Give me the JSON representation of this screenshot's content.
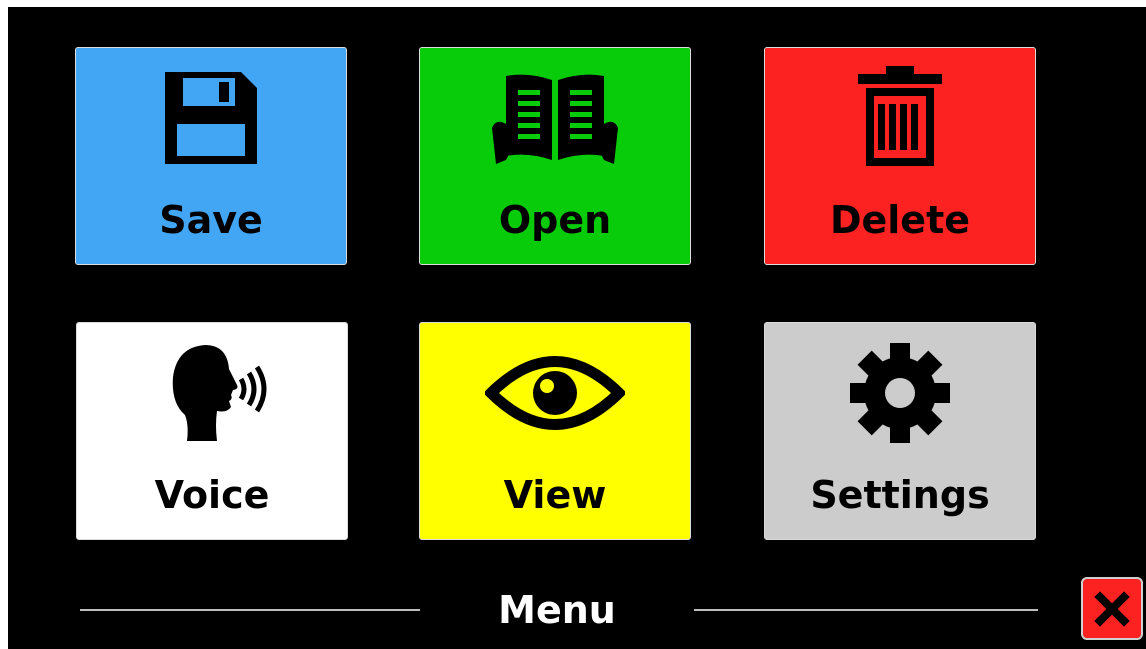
{
  "menu": {
    "title": "Menu",
    "tiles": [
      {
        "label": "Save",
        "icon": "floppy-disk-icon",
        "color": "#42a6f4"
      },
      {
        "label": "Open",
        "icon": "open-book-icon",
        "color": "#08cc0a"
      },
      {
        "label": "Delete",
        "icon": "trash-can-icon",
        "color": "#fd2222"
      },
      {
        "label": "Voice",
        "icon": "speaking-head-icon",
        "color": "#ffffff"
      },
      {
        "label": "View",
        "icon": "eye-icon",
        "color": "#ffff00"
      },
      {
        "label": "Settings",
        "icon": "gear-icon",
        "color": "#cccccc"
      }
    ],
    "close": {
      "icon": "close-icon",
      "color": "#fd2222"
    }
  }
}
